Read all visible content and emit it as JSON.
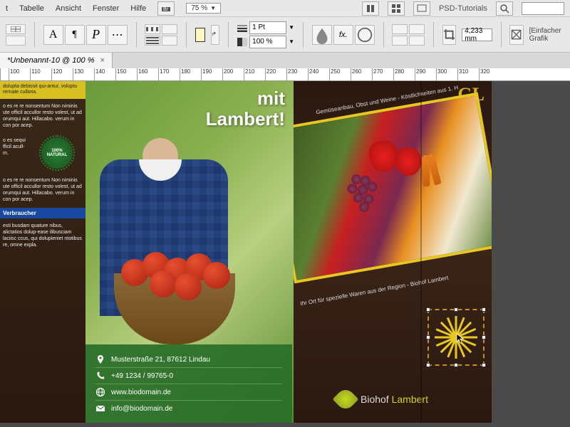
{
  "menu": {
    "items": [
      "t",
      "Tabelle",
      "Ansicht",
      "Fenster",
      "Hilfe"
    ],
    "zoom": "75 %",
    "brand": "PSD-Tutorials",
    "graphicLabel": "[Einfacher Grafik"
  },
  "toolbar": {
    "stroke": "1 Pt",
    "opacity": "100 %",
    "measure": "4,233 mm"
  },
  "document": {
    "tabTitle": "*Unbenannt-10 @ 100 %",
    "rulerTicks": [
      "100",
      "110",
      "120",
      "130",
      "140",
      "150",
      "160",
      "170",
      "180",
      "190",
      "200",
      "210",
      "220",
      "230",
      "240",
      "250",
      "260",
      "270",
      "280",
      "290",
      "300",
      "310",
      "320"
    ]
  },
  "leftcol": {
    "yellowBox": "dolupta debissit qui-antur, voluptu rernate culloria.",
    "block1": "o es re re nonsentum Non niminis ute officil accullor resto volest, ut ad orumqui aut. Hillacabo. verum in con por acep.",
    "block2": "o es\nsequi\nfficil\nacull-\nm.",
    "block3": "o es re re nonsentum Non niminis ute officil accullor resto volest, ut ad orumqui aut. Hillacabo. verum in con por acep.",
    "blueBar": "Verbraucher",
    "block4": "esti busdam quature nibus, alictatios dolup-ease ilibusciam laciisc ccus, qui dolupieniet ntotibus re, omne expla.",
    "badge": "100% NATURAL"
  },
  "headline": {
    "l1": "mit",
    "l2": "Lambert!"
  },
  "contact": {
    "address": "Musterstraße 21, 87612 Lindau",
    "phone": "+49 1234 / 99765-0",
    "web": "www.biodomain.de",
    "email": "info@biodomain.de"
  },
  "rightpage": {
    "glu": "GL",
    "diagTop": "Gemüseanbau, Obst und Weine - Köstlichkeiten aus 1. H",
    "diagBot": "Ihr Ort für spezielle Waren aus der Region - Biohof Lambert",
    "logoA": "Biohof ",
    "logoB": "Lambert"
  }
}
